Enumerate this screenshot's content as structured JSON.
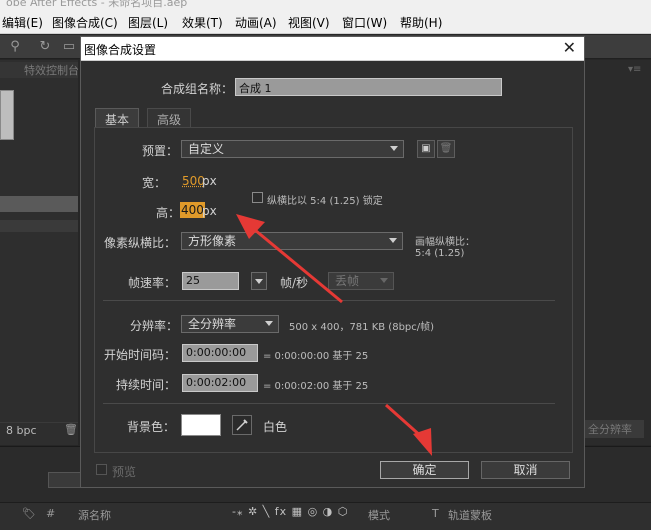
{
  "app": {
    "title_partial": "obe After Effects - 未命名项目.aep",
    "menu": [
      {
        "label": "编辑(E)"
      },
      {
        "label": "图像合成(C)"
      },
      {
        "label": "图层(L)"
      },
      {
        "label": "效果(T)"
      },
      {
        "label": "动画(A)"
      },
      {
        "label": "视图(V)"
      },
      {
        "label": "窗口(W)"
      },
      {
        "label": "帮助(H)"
      }
    ],
    "left_panel_tab": "特效控制台",
    "bpc": "8 bpc",
    "right_resolution": "全分辨率",
    "timeline": {
      "source_name": "源名称",
      "mode": "模式",
      "t": "T",
      "track_matte": "轨道蒙板",
      "icons": "-⁎ ✲ ╲ fx ▦ ◎ ◑ ⬡"
    }
  },
  "dialog": {
    "title": "图像合成设置",
    "comp_name_label": "合成组名称：",
    "comp_name_value": "合成 1",
    "tabs": [
      {
        "label": "基本"
      },
      {
        "label": "高级"
      }
    ],
    "preset_label": "预置：",
    "preset_value": "自定义",
    "width_label": "宽：",
    "width_value": "500",
    "height_label": "高：",
    "height_value": "400",
    "unit_px": "px",
    "lock_aspect_label": "纵横比以 5:4 (1.25) 锁定",
    "pixel_aspect_label": "像素纵横比：",
    "pixel_aspect_value": "方形像素",
    "frame_aspect_label": "画幅纵横比：",
    "frame_aspect_value": "5:4 (1.25)",
    "frame_rate_label": "帧速率：",
    "frame_rate_value": "25",
    "fps_label": "帧/秒",
    "drop_frame_value": "丢帧",
    "resolution_label": "分辨率：",
    "resolution_value": "全分辨率",
    "resolution_info": "500 x 400，781 KB (8bpc/帧)",
    "start_tc_label": "开始时间码：",
    "start_tc_value": "0:00:00:00",
    "start_tc_info": "= 0:00:00:00  基于 25",
    "duration_label": "持续时间：",
    "duration_value": "0:00:02:00",
    "duration_info": "= 0:00:02:00  基于 25",
    "bg_color_label": "背景色：",
    "bg_color_name": "白色",
    "bg_color_hex": "#ffffff",
    "preview_label": "预览",
    "ok_label": "确定",
    "cancel_label": "取消"
  },
  "colors": {
    "highlight": "#e09a2a",
    "annotation_arrow": "#e53935"
  }
}
